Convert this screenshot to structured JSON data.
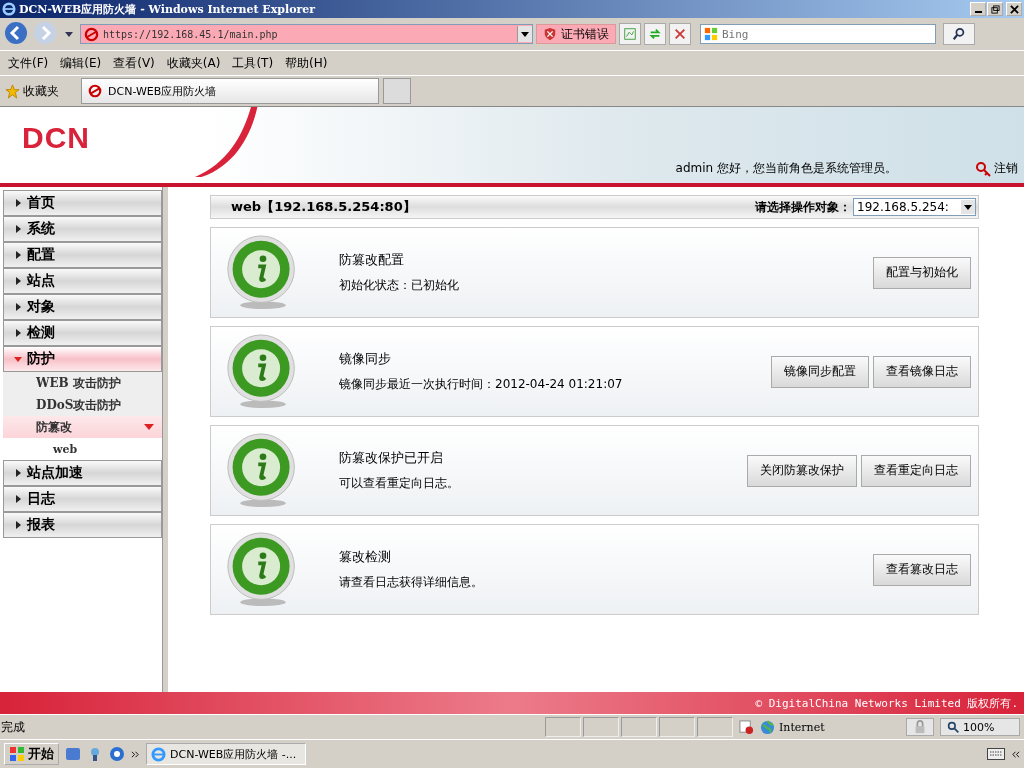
{
  "window": {
    "title": "DCN-WEB应用防火墙 - Windows Internet Explorer"
  },
  "browser": {
    "address": "https://192.168.45.1/main.php",
    "cert_error": "证书错误",
    "search_placeholder": "Bing",
    "menu": [
      "文件(F)",
      "编辑(E)",
      "查看(V)",
      "收藏夹(A)",
      "工具(T)",
      "帮助(H)"
    ],
    "favorites": "收藏夹",
    "tab_title": "DCN-WEB应用防火墙"
  },
  "header": {
    "logo": "DCN",
    "greeting": "admin 您好，您当前角色是系统管理员。",
    "logout": "注销"
  },
  "sidebar": {
    "items": [
      {
        "label": "首页",
        "expanded": false,
        "selected": false
      },
      {
        "label": "系统",
        "expanded": false,
        "selected": false
      },
      {
        "label": "配置",
        "expanded": false,
        "selected": false
      },
      {
        "label": "站点",
        "expanded": false,
        "selected": false
      },
      {
        "label": "对象",
        "expanded": false,
        "selected": false
      },
      {
        "label": "检测",
        "expanded": false,
        "selected": false
      },
      {
        "label": "防护",
        "expanded": true,
        "selected": true,
        "children": [
          {
            "label": "WEB 攻击防护",
            "expanded": false,
            "selected": false
          },
          {
            "label": "DDoS攻击防护",
            "expanded": false,
            "selected": false
          },
          {
            "label": "防篡改",
            "expanded": true,
            "selected": true,
            "children": [
              {
                "label": "web",
                "selected": false
              }
            ]
          }
        ]
      },
      {
        "label": "站点加速",
        "expanded": false,
        "selected": false
      },
      {
        "label": "日志",
        "expanded": false,
        "selected": false
      },
      {
        "label": "报表",
        "expanded": false,
        "selected": false
      }
    ]
  },
  "panel": {
    "title": "web【192.168.5.254:80】",
    "select_label": "请选择操作对象：",
    "select_value": "192.168.5.254:"
  },
  "cards": [
    {
      "title": "防篡改配置",
      "detail": "初始化状态：已初始化",
      "buttons": [
        "配置与初始化"
      ]
    },
    {
      "title": "镜像同步",
      "detail": "镜像同步最近一次执行时间：2012-04-24 01:21:07",
      "buttons": [
        "镜像同步配置",
        "查看镜像日志"
      ]
    },
    {
      "title": "防篡改保护已开启",
      "detail": "可以查看重定向日志。",
      "buttons": [
        "关闭防篡改保护",
        "查看重定向日志"
      ]
    },
    {
      "title": "篡改检测",
      "detail": "请查看日志获得详细信息。",
      "buttons": [
        "查看篡改日志"
      ]
    }
  ],
  "footer": "© DigitalChina Networks Limited 版权所有.",
  "status_bar": {
    "text": "完成",
    "zone": "Internet",
    "zoom": "100%"
  },
  "taskbar": {
    "start": "开始",
    "task": "DCN-WEB应用防火墙 -..."
  }
}
